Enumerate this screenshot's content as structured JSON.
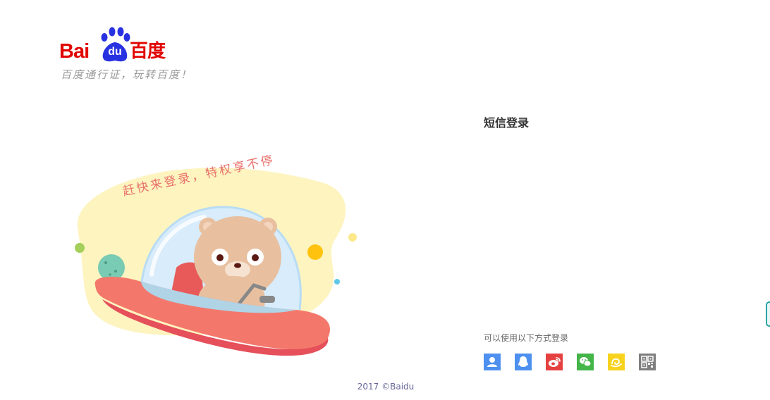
{
  "logo": {
    "bai": "Bai",
    "du": "du",
    "cn": "百度",
    "slogan": "百度通行证，玩转百度！"
  },
  "illustration": {
    "banner_text": "赶快来登录，特权享不停"
  },
  "login": {
    "title": "短信登录",
    "other_methods_label": "可以使用以下方式登录",
    "methods": [
      {
        "icon": "user-icon",
        "color": "#4d90f0"
      },
      {
        "icon": "qq-icon",
        "color": "#4d90f0"
      },
      {
        "icon": "weibo-icon",
        "color": "#e64141"
      },
      {
        "icon": "wechat-icon",
        "color": "#44b549"
      },
      {
        "icon": "yixin-icon",
        "color": "#f7d31e"
      },
      {
        "icon": "qrcode-icon",
        "color": "#7f7f7f"
      }
    ]
  },
  "footer": {
    "copyright": "2017 ©Baidu"
  },
  "colors": {
    "brand_red": "#e10601",
    "brand_blue": "#2932e1"
  }
}
